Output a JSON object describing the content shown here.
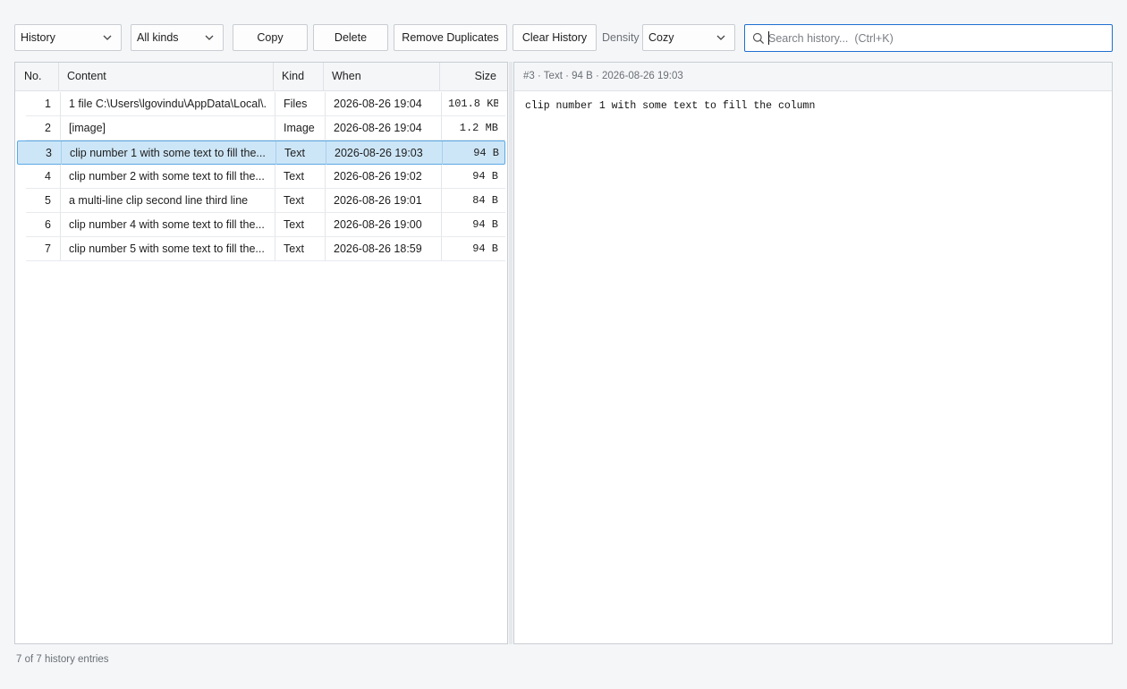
{
  "toolbar": {
    "view_select": "History",
    "kind_select": "All kinds",
    "copy_label": "Copy",
    "delete_label": "Delete",
    "remove_duplicates_label": "Remove Duplicates",
    "clear_history_label": "Clear History",
    "density_label": "Density",
    "density_select": "Cozy",
    "search_placeholder": "Search history...  (Ctrl+K)",
    "search_value": ""
  },
  "table": {
    "columns": [
      "No.",
      "Content",
      "Kind",
      "When",
      "Size"
    ],
    "rows": [
      {
        "no": "1",
        "content": "1 file C:\\Users\\lgovindu\\AppData\\Local\\...",
        "kind": "Files",
        "when": "2026-08-26 19:04",
        "size": "101.8 KB",
        "selected": false
      },
      {
        "no": "2",
        "content": "[image]",
        "kind": "Image",
        "when": "2026-08-26 19:04",
        "size": "1.2 MB",
        "selected": false
      },
      {
        "no": "3",
        "content": "clip number 1 with some text to fill the...",
        "kind": "Text",
        "when": "2026-08-26 19:03",
        "size": "94 B",
        "selected": true
      },
      {
        "no": "4",
        "content": "clip number 2 with some text to fill the...",
        "kind": "Text",
        "when": "2026-08-26 19:02",
        "size": "94 B",
        "selected": false
      },
      {
        "no": "5",
        "content": "a multi-line clip second line third line",
        "kind": "Text",
        "when": "2026-08-26 19:01",
        "size": "84 B",
        "selected": false
      },
      {
        "no": "6",
        "content": "clip number 4 with some text to fill the...",
        "kind": "Text",
        "when": "2026-08-26 19:00",
        "size": "94 B",
        "selected": false
      },
      {
        "no": "7",
        "content": "clip number 5 with some text to fill the...",
        "kind": "Text",
        "when": "2026-08-26 18:59",
        "size": "94 B",
        "selected": false
      }
    ]
  },
  "preview": {
    "header": "#3  ·  Text  ·  94 B  ·  2026-08-26 19:03",
    "content": "clip number 1 with some text to fill the column"
  },
  "status": "7 of 7 history entries",
  "colors": {
    "accent": "#1f6fd1",
    "selection_bg": "#cde6f7",
    "selection_border": "#5aa9e6"
  }
}
